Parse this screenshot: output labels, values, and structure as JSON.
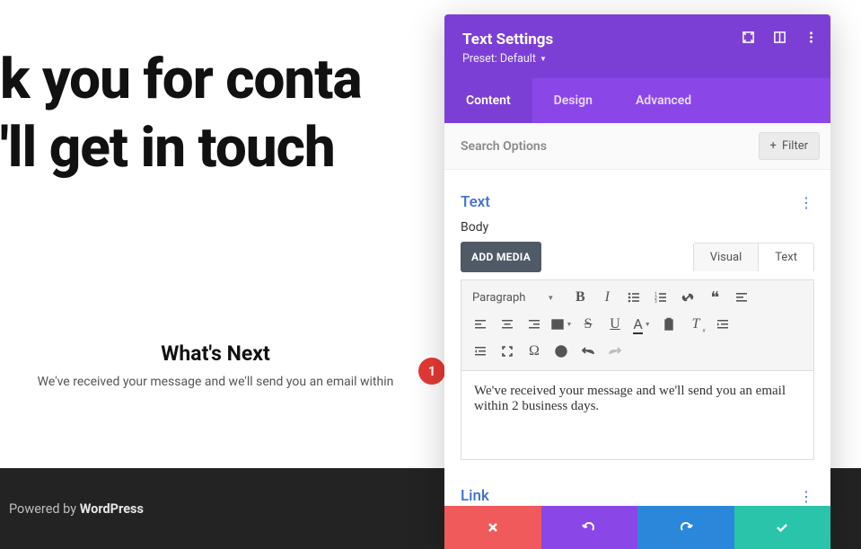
{
  "hero": {
    "line1": "k you for conta",
    "line2": "'ll get in touch"
  },
  "page": {
    "whatsNextTitle": "What's Next",
    "whatsNextBody": "We've received your message and we'll send you an email within"
  },
  "footer": {
    "prefix": "Powered by ",
    "brand": "WordPress"
  },
  "marker": {
    "num": "1"
  },
  "panel": {
    "title": "Text Settings",
    "presetLabel": "Preset: Default",
    "tabs": {
      "content": "Content",
      "design": "Design",
      "advanced": "Advanced"
    },
    "search": {
      "placeholder": "Search Options",
      "filter": "Filter"
    },
    "sections": {
      "text": "Text",
      "link": "Link"
    },
    "field": {
      "bodyLabel": "Body",
      "addMedia": "ADD MEDIA"
    },
    "editorTabs": {
      "visual": "Visual",
      "text": "Text"
    },
    "formatSelect": "Paragraph",
    "editorContent": "We've received your message and we'll send you an email within 2 business days."
  }
}
